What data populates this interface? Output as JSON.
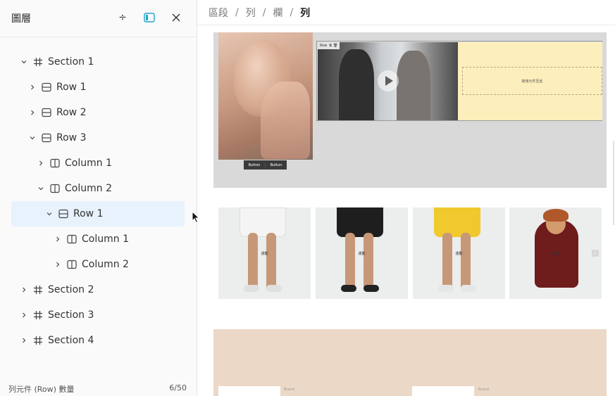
{
  "panel": {
    "title": "圖層",
    "footer_label": "列元件 (Row) 數量",
    "footer_count": "6/50"
  },
  "tree": [
    {
      "label": "Section 1",
      "type": "section",
      "expanded": true
    },
    {
      "label": "Row 1",
      "type": "row",
      "expanded": false
    },
    {
      "label": "Row 2",
      "type": "row",
      "expanded": false
    },
    {
      "label": "Row 3",
      "type": "row",
      "expanded": true
    },
    {
      "label": "Column 1",
      "type": "column",
      "expanded": false
    },
    {
      "label": "Column 2",
      "type": "column",
      "expanded": true
    },
    {
      "label": "Row 1",
      "type": "row",
      "expanded": true,
      "selected": true
    },
    {
      "label": "Column 1",
      "type": "column",
      "expanded": false
    },
    {
      "label": "Column 2",
      "type": "column",
      "expanded": false
    },
    {
      "label": "Section 2",
      "type": "section",
      "expanded": false
    },
    {
      "label": "Section 3",
      "type": "section",
      "expanded": false
    },
    {
      "label": "Section 4",
      "type": "section",
      "expanded": false
    }
  ],
  "breadcrumb": {
    "items": [
      "區段",
      "列",
      "欄",
      "列"
    ],
    "separator": "/"
  },
  "canvas": {
    "button_labels": [
      "Button",
      "Button"
    ],
    "row_tag": "Row",
    "drop_text": "拖曳元件至此",
    "product_label": "運動",
    "brand_label": "Brand"
  },
  "colors": {
    "selected_bg": "#e8f2fc",
    "section1_bg": "#d9d9d9",
    "yellow_col": "#fdefbb",
    "section3_bg": "#ecd8c7",
    "accent": "#22a5c9"
  }
}
